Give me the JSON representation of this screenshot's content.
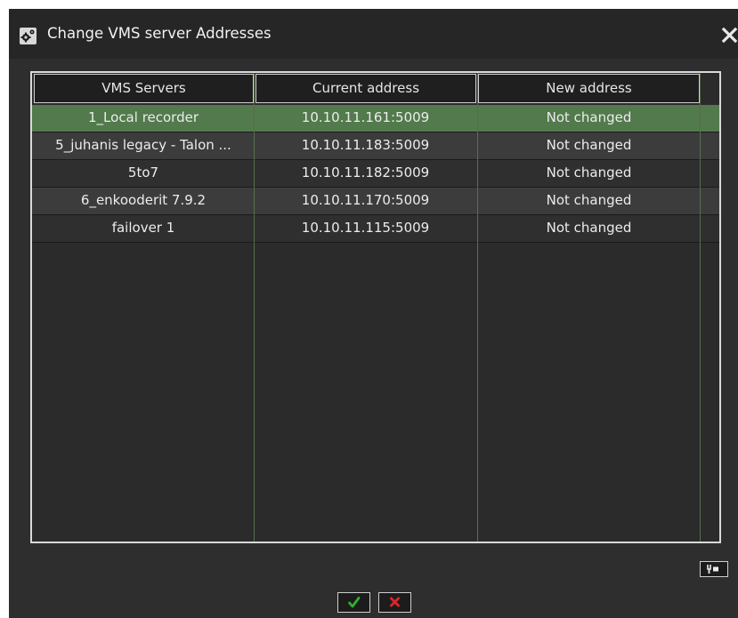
{
  "dialog": {
    "title": "Change VMS server Addresses",
    "title_icon": "gear-icon",
    "close_icon": "close-icon"
  },
  "table": {
    "columns": [
      "VMS Servers",
      "Current address",
      "New address"
    ],
    "rows": [
      {
        "server": "1_Local recorder",
        "current": "10.10.11.161:5009",
        "new": "Not changed",
        "selected": true
      },
      {
        "server": "5_juhanis legacy - Talon ...",
        "current": "10.10.11.183:5009",
        "new": "Not changed",
        "selected": false
      },
      {
        "server": "5to7",
        "current": "10.10.11.182:5009",
        "new": "Not changed",
        "selected": false
      },
      {
        "server": "6_enkooderit 7.9.2",
        "current": "10.10.11.170:5009",
        "new": "Not changed",
        "selected": false
      },
      {
        "server": "failover 1",
        "current": "10.10.11.115:5009",
        "new": "Not changed",
        "selected": false
      }
    ]
  },
  "buttons": {
    "filter_icon": "filter-icon",
    "ok_icon": "checkmark-icon",
    "cancel_icon": "cross-icon"
  },
  "colors": {
    "selected_row": "#527a4c",
    "row_light": "#3c3c3c",
    "row_dark": "#2f2f2f",
    "grid_line": "#56704a",
    "ok_green": "#2fb02f",
    "cancel_red": "#d8262a"
  }
}
